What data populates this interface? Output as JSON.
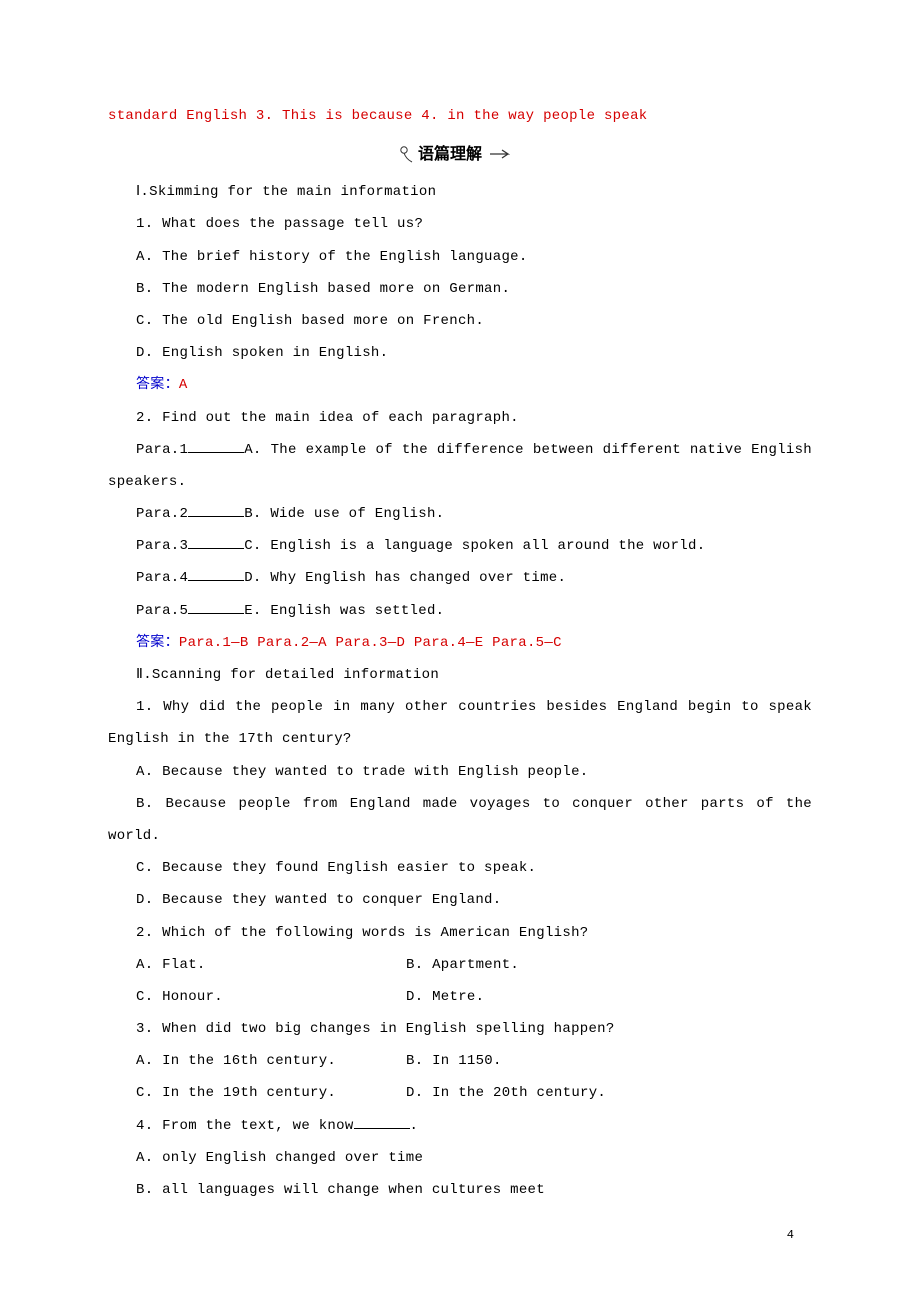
{
  "topLine": "standard English 3. This is because 4. in the way people speak",
  "sectionHeader": "语篇理解",
  "part1": {
    "heading": "Ⅰ.Skimming for the main information",
    "q1": {
      "stem": "1. What does the passage tell us?",
      "a": "A. The brief history of the English language.",
      "b": "B. The modern English based more on German.",
      "c": "C. The old English based more on French.",
      "d": "D. English spoken in English.",
      "answerLabel": "答案：",
      "answerValue": "A"
    },
    "q2": {
      "stem": "2. Find out the main idea of each paragraph.",
      "rows": [
        {
          "left": "Para.1",
          "right": "A. The example of the difference between different native English speakers."
        },
        {
          "left": "Para.2",
          "right": "B. Wide use of English."
        },
        {
          "left": "Para.3",
          "right": "C. English is a language spoken all around the world."
        },
        {
          "left": "Para.4",
          "right": "D. Why English has changed over time."
        },
        {
          "left": "Para.5",
          "right": "E. English was settled."
        }
      ],
      "answerLabel": "答案：",
      "answerValue": "Para.1—B  Para.2—A  Para.3—D  Para.4—E Para.5—C"
    }
  },
  "part2": {
    "heading": "Ⅱ.Scanning for detailed information",
    "q1": {
      "stem": "1. Why did the people in many other countries besides England begin to speak English in the 17th century?",
      "a": "A. Because they wanted to trade with English people.",
      "b": "B. Because people from England made voyages to conquer other parts of the world.",
      "c": "C. Because they found English easier to speak.",
      "d": "D. Because they wanted to conquer England."
    },
    "q2": {
      "stem": "2. Which of the following words is American English?",
      "a": "A. Flat.",
      "b": "B. Apartment.",
      "c": "C. Honour.",
      "d": "D. Metre."
    },
    "q3": {
      "stem": "3. When did two big changes in English spelling happen?",
      "a": "A. In the 16th century.",
      "b": "B. In 1150.",
      "c": "C. In the 19th century.",
      "d": "D. In the 20th century."
    },
    "q4": {
      "stemPrefix": "4. From the text, we know",
      "stemSuffix": ".",
      "a": "A. only English changed over time",
      "b": "B. all languages will change when cultures meet"
    }
  },
  "pageNumber": "4"
}
